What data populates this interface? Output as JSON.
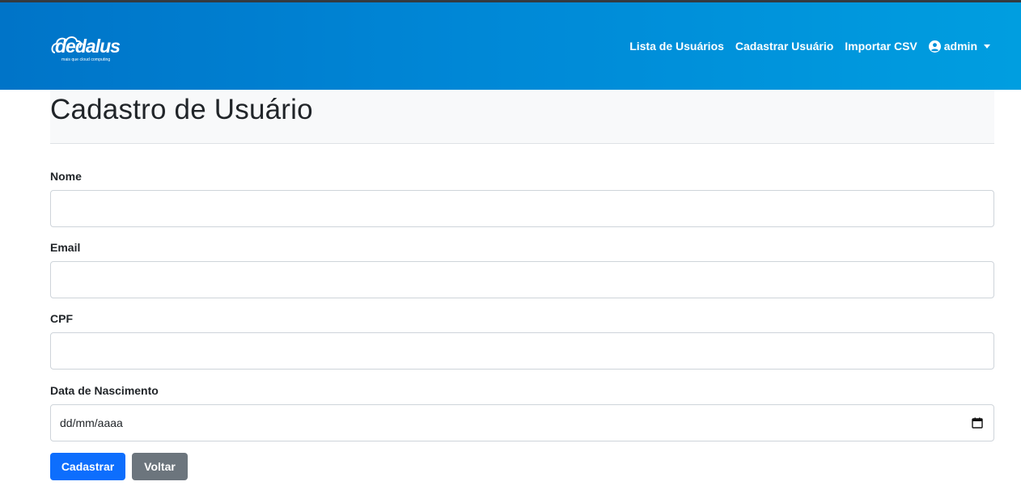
{
  "brand": {
    "logo_text": "dedalus",
    "tagline": "mais que cloud computing"
  },
  "nav": {
    "links": [
      "Lista de Usuários",
      "Cadastrar Usuário",
      "Importar CSV"
    ],
    "user_label": "admin"
  },
  "page": {
    "title": "Cadastro de Usuário"
  },
  "form": {
    "nome_label": "Nome",
    "nome_value": "",
    "email_label": "Email",
    "email_value": "",
    "cpf_label": "CPF",
    "cpf_value": "",
    "nascimento_label": "Data de Nascimento",
    "nascimento_placeholder": "dd/mm/aaaa"
  },
  "buttons": {
    "submit_label": "Cadastrar",
    "back_label": "Voltar"
  },
  "icons": {
    "user": "user-circle-icon",
    "caret": "chevron-down-icon",
    "calendar": "calendar-icon"
  },
  "colors": {
    "navbar_start": "#0074c8",
    "navbar_end": "#009ee0",
    "primary": "#0d6efd",
    "secondary": "#6c757d"
  }
}
